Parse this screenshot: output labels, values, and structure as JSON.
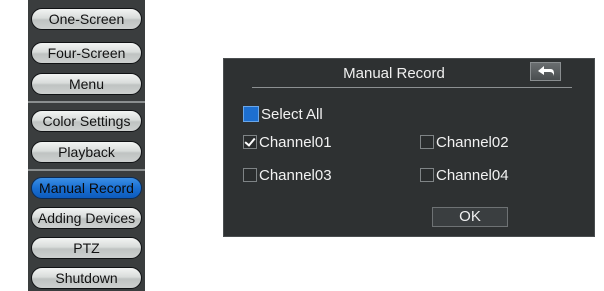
{
  "side_menu": {
    "items": [
      {
        "label": "One-Screen"
      },
      {
        "label": "Four-Screen"
      },
      {
        "label": "Menu"
      },
      {
        "label": "Color Settings"
      },
      {
        "label": "Playback"
      },
      {
        "label": "Manual Record",
        "active": true
      },
      {
        "label": "Adding Devices"
      },
      {
        "label": "PTZ"
      },
      {
        "label": "Shutdown"
      }
    ]
  },
  "dialog": {
    "title": "Manual Record",
    "back_icon": "back-arrow-icon",
    "select_all": {
      "label": "Select All",
      "checked": false
    },
    "channels": [
      {
        "label": "Channel01",
        "checked": true
      },
      {
        "label": "Channel02",
        "checked": false
      },
      {
        "label": "Channel03",
        "checked": false
      },
      {
        "label": "Channel04",
        "checked": false
      }
    ],
    "ok_label": "OK"
  },
  "colors": {
    "menu_bg": "#3a3d3e",
    "active_button": "#1a6fd2",
    "dialog_bg": "#2e3132"
  }
}
